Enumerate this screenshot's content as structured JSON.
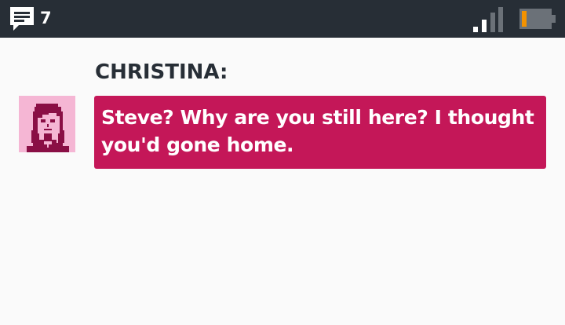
{
  "status_bar": {
    "message_icon": "chat-bubble-icon",
    "message_count": "7",
    "signal_icon": "signal-strength-icon",
    "battery_icon": "battery-low-icon",
    "colors": {
      "bar": "#272e36",
      "battery_fill": "#f39200",
      "signal_active": "#ffffff",
      "signal_inactive": "#6b7178"
    }
  },
  "conversation": {
    "speaker": "CHRISTINA:",
    "avatar_icon": "christina-portrait",
    "message": "Steve? Why are you still here? I thought you'd gone home.",
    "colors": {
      "bubble": "#c41758",
      "avatar_bg": "#f5b6d4",
      "avatar_ink": "#8a0f45"
    }
  }
}
